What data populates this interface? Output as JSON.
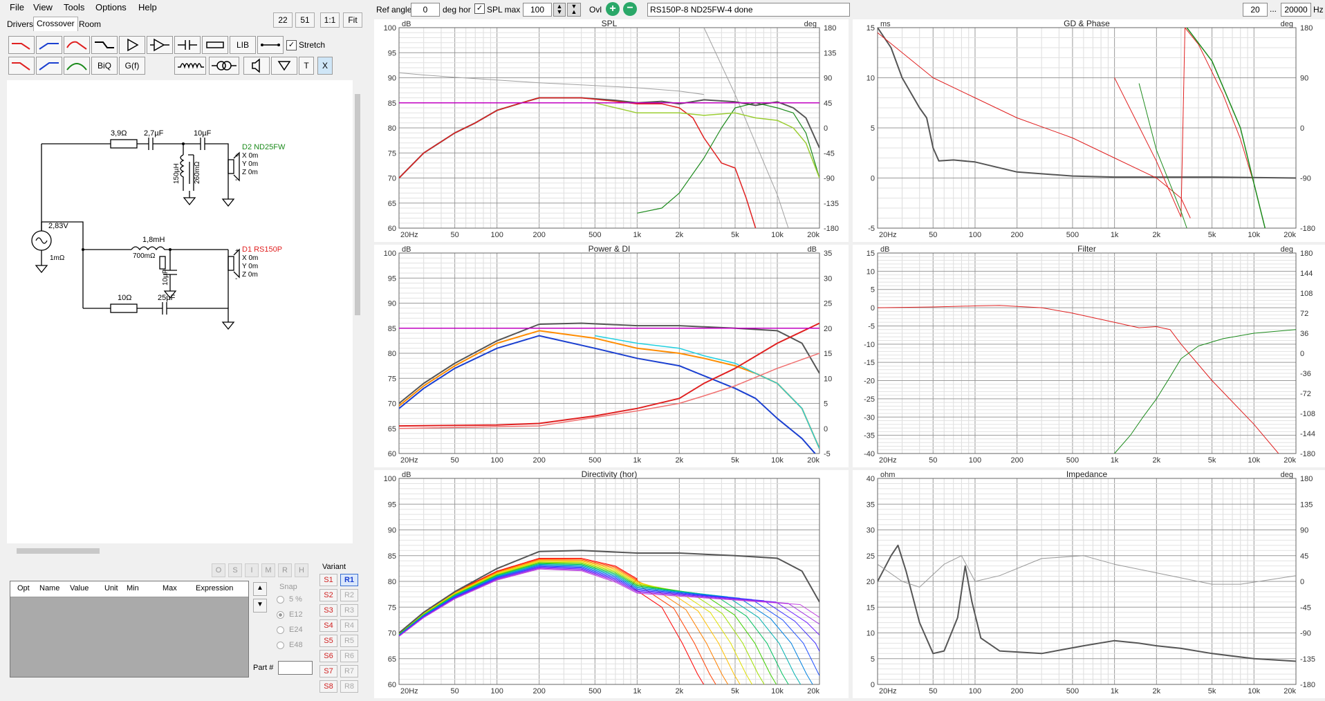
{
  "menu": [
    "File",
    "View",
    "Tools",
    "Options",
    "Help"
  ],
  "tabs": [
    "Drivers",
    "Crossover",
    "Room"
  ],
  "toolbar": {
    "zoom1": "22",
    "zoom2": "51",
    "zoom3": "1:1",
    "fit": "Fit",
    "ref_angle_label": "Ref angle",
    "ref_angle_value": "0",
    "deg_hor": "deg hor",
    "spl_max_label": "SPL max",
    "spl_max_value": "100",
    "ovl": "Ovl",
    "project_name": "RS150P-8 ND25FW-4 done",
    "freq_min": "20",
    "freq_dots": "...",
    "freq_max": "20000",
    "hz": "Hz"
  },
  "crossover_toolbar": {
    "lib": "LIB",
    "biq": "BiQ",
    "gf": "G(f)",
    "stretch": "Stretch",
    "t": "T",
    "x": "X"
  },
  "schematic": {
    "r1": "3,9Ω",
    "c1": "2,7µF",
    "c2": "10µF",
    "l1": "150µH",
    "r2": "260mΩ",
    "d2_name": "D2 ND25FW",
    "d2_x": "X 0m",
    "d2_y": "Y 0m",
    "d2_z": "Z 0m",
    "src_v": "2,83V",
    "src_r": "1mΩ",
    "l2": "1,8mH",
    "r3": "700mΩ",
    "c3": "10µF",
    "d1_name": "D1 RS150P",
    "d1_x": "X 0m",
    "d1_y": "Y 0m",
    "d1_z": "Z 0m",
    "r4": "10Ω",
    "c4": "25µF",
    "plus": "+",
    "minus": "-"
  },
  "opt_buttons": [
    "O",
    "S",
    "I",
    "M",
    "R",
    "H"
  ],
  "param_table": {
    "headers": [
      "Opt",
      "Name",
      "Value",
      "Unit",
      "Min",
      "Max",
      "Expression"
    ]
  },
  "snap": {
    "label": "Snap",
    "options": [
      "5 %",
      "E12",
      "E24",
      "E48"
    ]
  },
  "part_label": "Part #",
  "variant": {
    "label": "Variant",
    "s": [
      "S1",
      "S2",
      "S3",
      "S4",
      "S5",
      "S6",
      "S7",
      "S8"
    ],
    "r": [
      "R1",
      "R2",
      "R3",
      "R4",
      "R5",
      "R6",
      "R7",
      "R8"
    ]
  },
  "colors": {
    "red": "#e02020",
    "blue": "#1a3fd0",
    "green": "#1b8a1b",
    "magenta": "#c000c0"
  },
  "freq_ticks": [
    "20Hz",
    "50",
    "100",
    "200",
    "500",
    "1k",
    "2k",
    "5k",
    "10k",
    "20k"
  ],
  "charts": {
    "spl": {
      "title": "SPL",
      "unit_left": "dB",
      "unit_right": "deg",
      "y_left": [
        "100",
        "95",
        "90",
        "85",
        "80",
        "75",
        "70",
        "65",
        "60"
      ],
      "y_right": [
        "180",
        "135",
        "90",
        "45",
        "0",
        "-45",
        "-90",
        "-135",
        "-180"
      ]
    },
    "gd": {
      "title": "GD & Phase",
      "unit_left": "ms",
      "unit_right": "deg",
      "y_left": [
        "15",
        "10",
        "5",
        "0",
        "-5"
      ],
      "y_right": [
        "180",
        "90",
        "0",
        "-90",
        "-180"
      ]
    },
    "power": {
      "title": "Power & DI",
      "unit_left": "dB",
      "unit_right": "dB",
      "y_left": [
        "100",
        "95",
        "90",
        "85",
        "80",
        "75",
        "70",
        "65",
        "60"
      ],
      "y_right": [
        "35",
        "30",
        "25",
        "20",
        "15",
        "10",
        "5",
        "0",
        "-5"
      ]
    },
    "filter": {
      "title": "Filter",
      "unit_left": "dB",
      "unit_right": "deg",
      "y_left": [
        "15",
        "10",
        "5",
        "0",
        "-5",
        "-10",
        "-15",
        "-20",
        "-25",
        "-30",
        "-35",
        "-40"
      ],
      "y_right": [
        "180",
        "144",
        "108",
        "72",
        "36",
        "0",
        "-36",
        "-72",
        "-108",
        "-144",
        "-180"
      ]
    },
    "directivity": {
      "title": "Directivity (hor)",
      "unit_left": "dB",
      "y_left": [
        "100",
        "95",
        "90",
        "85",
        "80",
        "75",
        "70",
        "65",
        "60"
      ]
    },
    "impedance": {
      "title": "Impedance",
      "unit_left": "ohm",
      "unit_right": "deg",
      "y_left": [
        "40",
        "35",
        "30",
        "25",
        "20",
        "15",
        "10",
        "5",
        "0"
      ],
      "y_right": [
        "180",
        "135",
        "90",
        "45",
        "0",
        "-45",
        "-90",
        "-135",
        "-180"
      ]
    }
  }
}
